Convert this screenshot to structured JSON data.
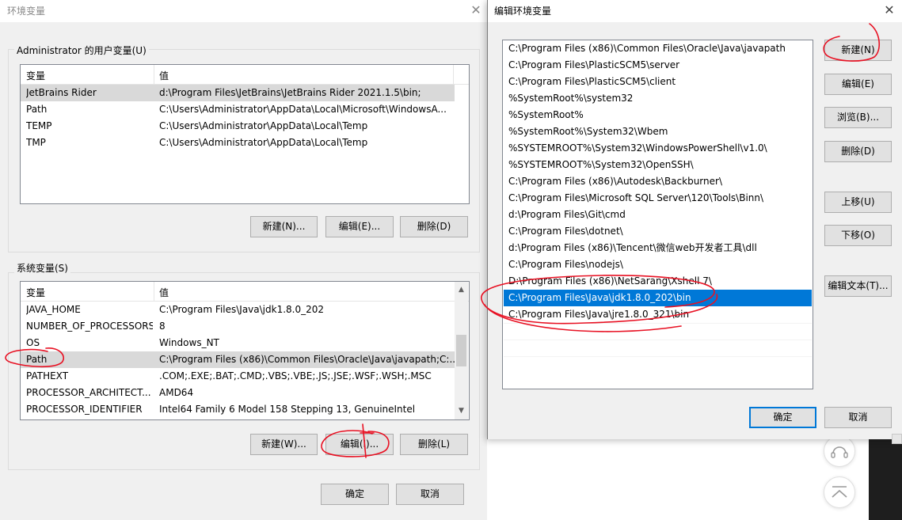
{
  "env_window": {
    "title": "环境变量",
    "user_group_title": "Administrator 的用户变量(U)",
    "user_columns": [
      "变量",
      "值"
    ],
    "user_vars": [
      {
        "name": "JetBrains Rider",
        "value": "d:\\Program Files\\JetBrains\\JetBrains Rider 2021.1.5\\bin;"
      },
      {
        "name": "Path",
        "value": "C:\\Users\\Administrator\\AppData\\Local\\Microsoft\\WindowsA..."
      },
      {
        "name": "TEMP",
        "value": "C:\\Users\\Administrator\\AppData\\Local\\Temp"
      },
      {
        "name": "TMP",
        "value": "C:\\Users\\Administrator\\AppData\\Local\\Temp"
      }
    ],
    "user_buttons": {
      "new": "新建(N)...",
      "edit": "编辑(E)...",
      "delete": "删除(D)"
    },
    "system_group_title": "系统变量(S)",
    "system_columns": [
      "变量",
      "值"
    ],
    "system_vars": [
      {
        "name": "JAVA_HOME",
        "value": "C:\\Program Files\\Java\\jdk1.8.0_202"
      },
      {
        "name": "NUMBER_OF_PROCESSORS",
        "value": "8"
      },
      {
        "name": "OS",
        "value": "Windows_NT"
      },
      {
        "name": "Path",
        "value": "C:\\Program Files (x86)\\Common Files\\Oracle\\Java\\javapath;C:..."
      },
      {
        "name": "PATHEXT",
        "value": ".COM;.EXE;.BAT;.CMD;.VBS;.VBE;.JS;.JSE;.WSF;.WSH;.MSC"
      },
      {
        "name": "PROCESSOR_ARCHITECT...",
        "value": "AMD64"
      },
      {
        "name": "PROCESSOR_IDENTIFIER",
        "value": "Intel64 Family 6 Model 158 Stepping 13, GenuineIntel"
      }
    ],
    "system_buttons": {
      "new": "新建(W)...",
      "edit": "编辑(I)...",
      "delete": "删除(L)"
    },
    "ok": "确定",
    "cancel": "取消"
  },
  "edit_dialog": {
    "title": "编辑环境变量",
    "paths": [
      "C:\\Program Files (x86)\\Common Files\\Oracle\\Java\\javapath",
      "C:\\Program Files\\PlasticSCM5\\server",
      "C:\\Program Files\\PlasticSCM5\\client",
      "%SystemRoot%\\system32",
      "%SystemRoot%",
      "%SystemRoot%\\System32\\Wbem",
      "%SYSTEMROOT%\\System32\\WindowsPowerShell\\v1.0\\",
      "%SYSTEMROOT%\\System32\\OpenSSH\\",
      "C:\\Program Files (x86)\\Autodesk\\Backburner\\",
      "C:\\Program Files\\Microsoft SQL Server\\120\\Tools\\Binn\\",
      "d:\\Program Files\\Git\\cmd",
      "C:\\Program Files\\dotnet\\",
      "d:\\Program Files (x86)\\Tencent\\微信web开发者工具\\dll",
      "C:\\Program Files\\nodejs\\",
      "D:\\Program Files (x86)\\NetSarang\\Xshell 7\\",
      "C:\\Program Files\\Java\\jdk1.8.0_202\\bin",
      "C:\\Program Files\\Java\\jre1.8.0_321\\bin"
    ],
    "selected_index": 15,
    "buttons": {
      "new": "新建(N)",
      "edit": "编辑(E)",
      "browse": "浏览(B)...",
      "delete": "删除(D)",
      "move_up": "上移(U)",
      "move_down": "下移(O)",
      "edit_text": "编辑文本(T)..."
    },
    "ok": "确定",
    "cancel": "取消"
  },
  "colors": {
    "selection_blue": "#0078d7",
    "annotation_red": "#e81123"
  }
}
